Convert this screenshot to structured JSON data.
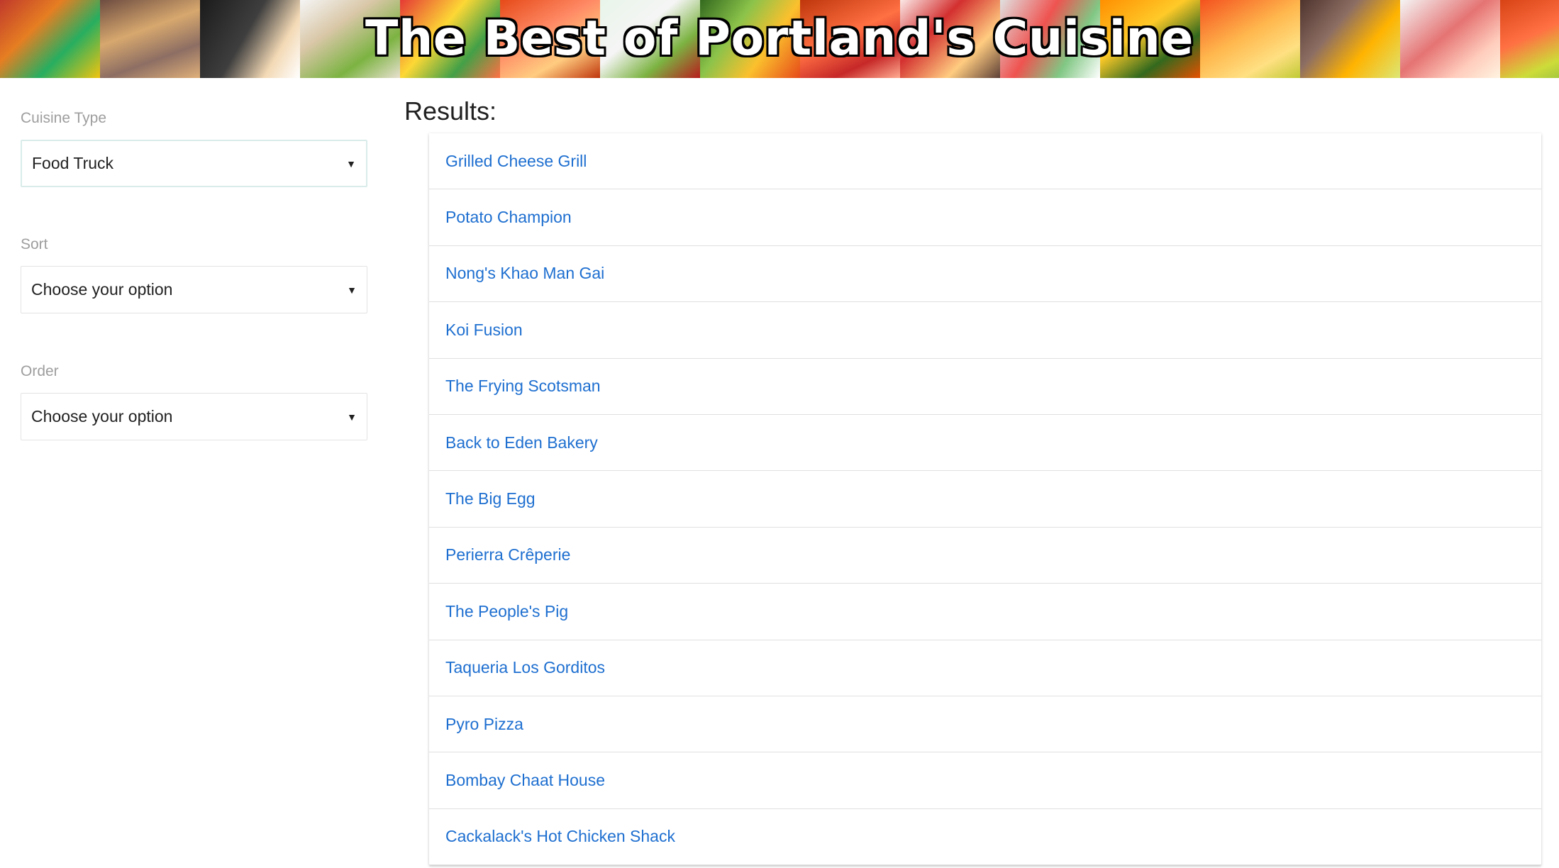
{
  "banner": {
    "title": "The Best of Portland's Cuisine"
  },
  "filters": {
    "cuisine": {
      "label": "Cuisine Type",
      "value": "Food Truck"
    },
    "sort": {
      "label": "Sort",
      "value": "Choose your option"
    },
    "order": {
      "label": "Order",
      "value": "Choose your option"
    }
  },
  "results": {
    "title": "Results:",
    "items": [
      "Grilled Cheese Grill",
      "Potato Champion",
      "Nong's Khao Man Gai",
      "Koi Fusion",
      "The Frying Scotsman",
      "Back to Eden Bakery",
      "The Big Egg",
      "Perierra Crêperie",
      "The People's Pig",
      "Taqueria Los Gorditos",
      "Pyro Pizza",
      "Bombay Chaat House",
      "Cackalack's Hot Chicken Shack"
    ]
  },
  "colors": {
    "link": "#1e6fd0",
    "label": "#9e9e9e",
    "focus_border": "#d9ecea"
  }
}
